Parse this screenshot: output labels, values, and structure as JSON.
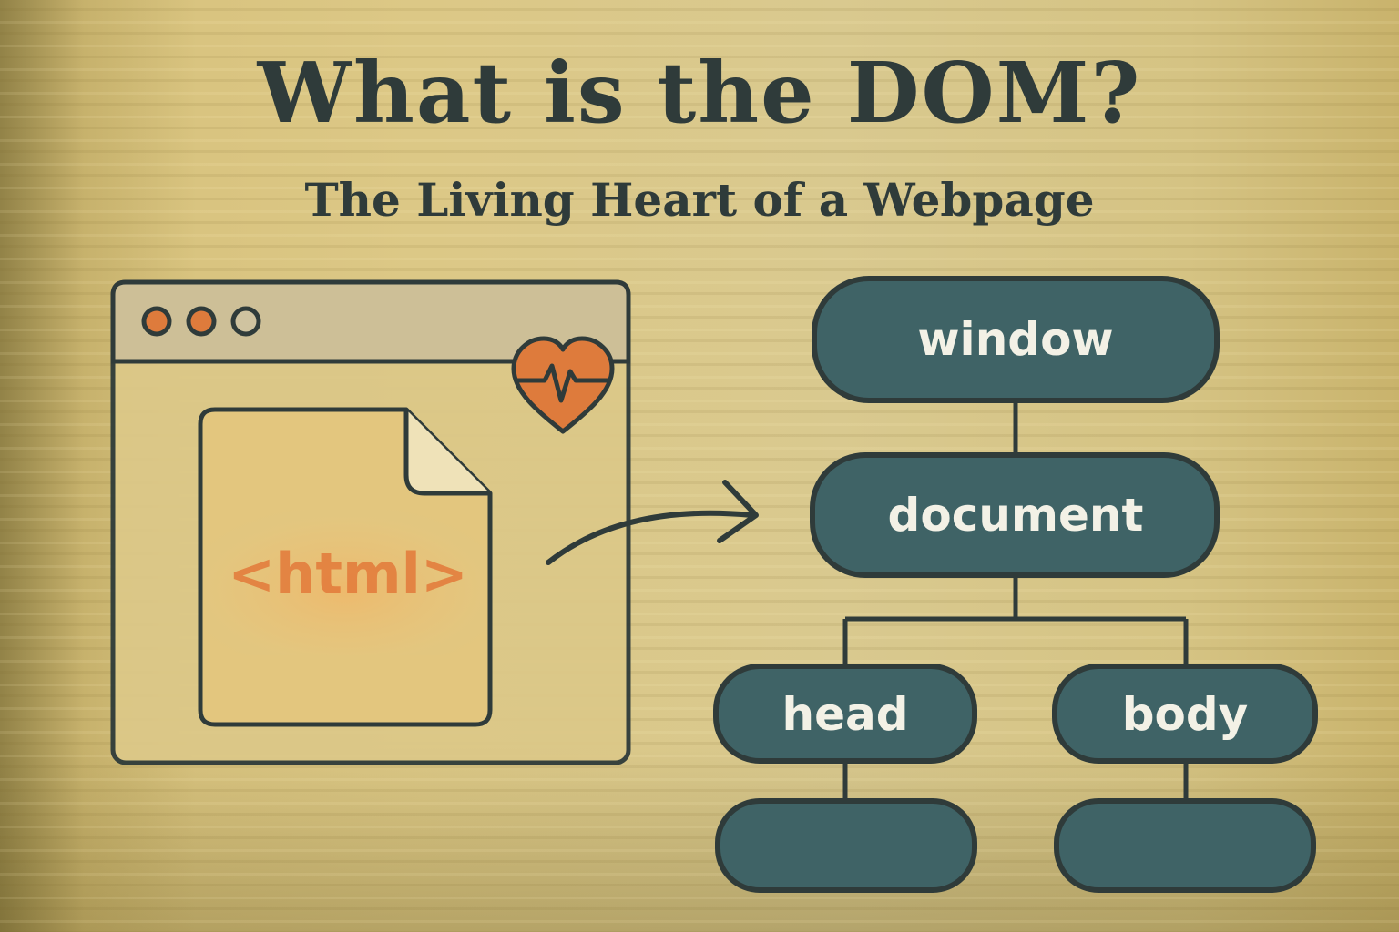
{
  "title": "What is the DOM?",
  "subtitle": "The Living Heart of a Webpage",
  "browser": {
    "file_label": "<html>",
    "window_buttons": [
      "orange-dot",
      "orange-dot",
      "gray-dot"
    ],
    "badge_icon": "heart-pulse-icon"
  },
  "tree": {
    "nodes": {
      "window": "window",
      "document": "document",
      "head": "head",
      "body": "body",
      "head_child": "",
      "body_child": ""
    }
  },
  "colors": {
    "ink": "#2f3b3a",
    "node_fill": "#3f6366",
    "accent_orange": "#de7b3c",
    "node_text": "#f3f1e6",
    "page_bg": "#d9c68a"
  }
}
